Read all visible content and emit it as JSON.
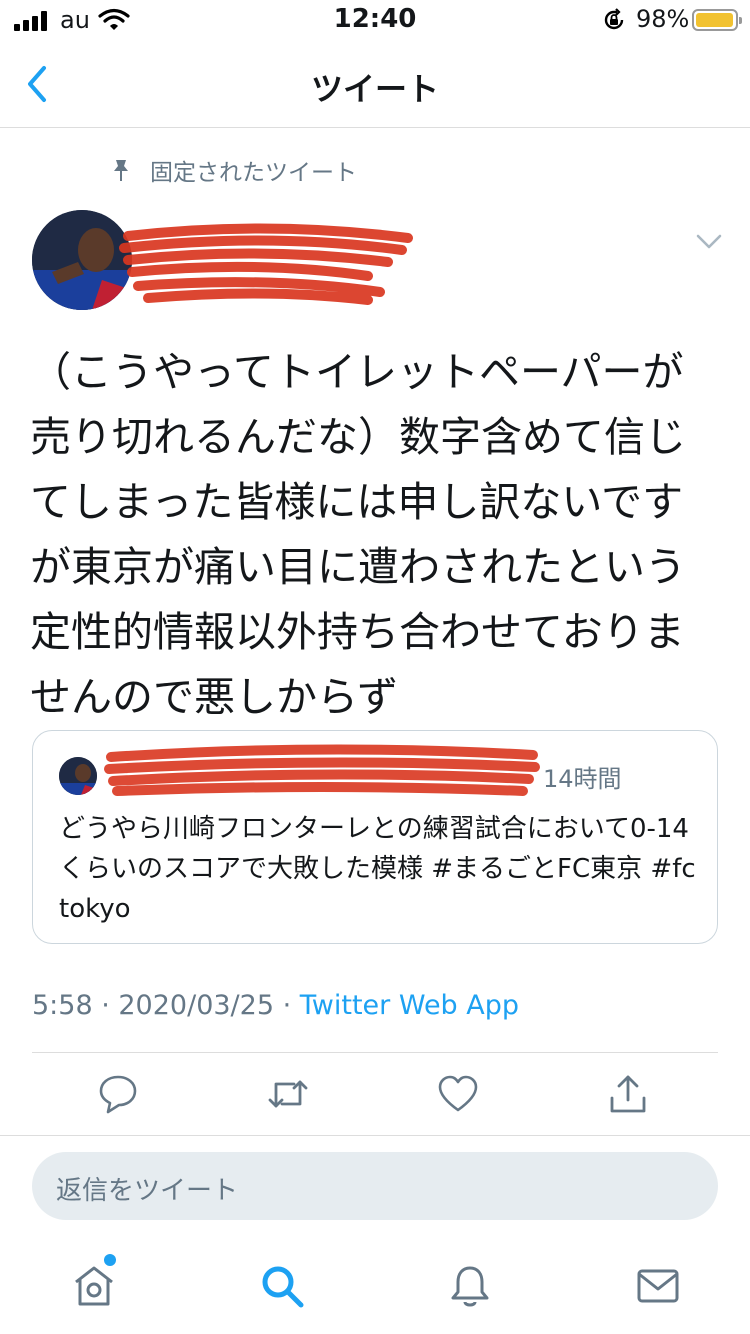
{
  "status_bar": {
    "carrier": "au",
    "time": "12:40",
    "battery_percent": "98%",
    "battery_level": 0.98,
    "battery_color": "#f2c230"
  },
  "nav": {
    "title": "ツイート"
  },
  "tweet": {
    "pinned_label": "固定されたツイート",
    "text": "（こうやってトイレットペーパーが売り切れるんだな）数字含めて信じてしまった皆様には申し訳ないですが東京が痛い目に遭わされたという定性的情報以外持ち合わせておりませんので悪しからず",
    "timestamp": "5:58 · 2020/03/25 · ",
    "source_app": "Twitter Web App"
  },
  "quoted_tweet": {
    "time": "14時間",
    "text": "どうやら川崎フロンターレとの練習試合において0-14くらいのスコアで大敗した模様 #まるごとFC東京 #fctokyo"
  },
  "reply": {
    "placeholder": "返信をツイート"
  },
  "icons": {
    "back": "chevron-left-icon",
    "pin": "pin-icon",
    "more": "chevron-down-icon",
    "actions": [
      "reply-icon",
      "retweet-icon",
      "like-icon",
      "share-icon"
    ],
    "tabs": [
      "home-icon",
      "search-icon",
      "notifications-icon",
      "messages-icon"
    ]
  },
  "colors": {
    "accent": "#1da1f2",
    "secondary_text": "#657786",
    "redaction": "#d9361f"
  }
}
